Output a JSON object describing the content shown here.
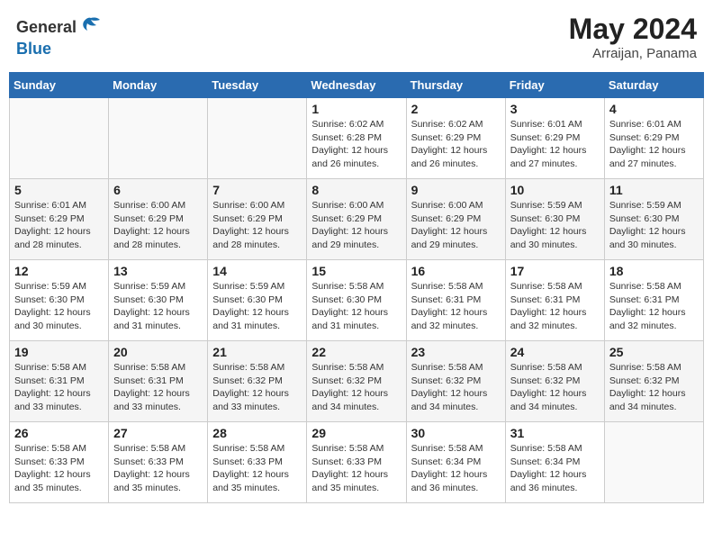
{
  "header": {
    "logo_general": "General",
    "logo_blue": "Blue",
    "month_year": "May 2024",
    "location": "Arraijan, Panama"
  },
  "weekdays": [
    "Sunday",
    "Monday",
    "Tuesday",
    "Wednesday",
    "Thursday",
    "Friday",
    "Saturday"
  ],
  "weeks": [
    [
      {
        "day": "",
        "info": ""
      },
      {
        "day": "",
        "info": ""
      },
      {
        "day": "",
        "info": ""
      },
      {
        "day": "1",
        "info": "Sunrise: 6:02 AM\nSunset: 6:28 PM\nDaylight: 12 hours\nand 26 minutes."
      },
      {
        "day": "2",
        "info": "Sunrise: 6:02 AM\nSunset: 6:29 PM\nDaylight: 12 hours\nand 26 minutes."
      },
      {
        "day": "3",
        "info": "Sunrise: 6:01 AM\nSunset: 6:29 PM\nDaylight: 12 hours\nand 27 minutes."
      },
      {
        "day": "4",
        "info": "Sunrise: 6:01 AM\nSunset: 6:29 PM\nDaylight: 12 hours\nand 27 minutes."
      }
    ],
    [
      {
        "day": "5",
        "info": "Sunrise: 6:01 AM\nSunset: 6:29 PM\nDaylight: 12 hours\nand 28 minutes."
      },
      {
        "day": "6",
        "info": "Sunrise: 6:00 AM\nSunset: 6:29 PM\nDaylight: 12 hours\nand 28 minutes."
      },
      {
        "day": "7",
        "info": "Sunrise: 6:00 AM\nSunset: 6:29 PM\nDaylight: 12 hours\nand 28 minutes."
      },
      {
        "day": "8",
        "info": "Sunrise: 6:00 AM\nSunset: 6:29 PM\nDaylight: 12 hours\nand 29 minutes."
      },
      {
        "day": "9",
        "info": "Sunrise: 6:00 AM\nSunset: 6:29 PM\nDaylight: 12 hours\nand 29 minutes."
      },
      {
        "day": "10",
        "info": "Sunrise: 5:59 AM\nSunset: 6:30 PM\nDaylight: 12 hours\nand 30 minutes."
      },
      {
        "day": "11",
        "info": "Sunrise: 5:59 AM\nSunset: 6:30 PM\nDaylight: 12 hours\nand 30 minutes."
      }
    ],
    [
      {
        "day": "12",
        "info": "Sunrise: 5:59 AM\nSunset: 6:30 PM\nDaylight: 12 hours\nand 30 minutes."
      },
      {
        "day": "13",
        "info": "Sunrise: 5:59 AM\nSunset: 6:30 PM\nDaylight: 12 hours\nand 31 minutes."
      },
      {
        "day": "14",
        "info": "Sunrise: 5:59 AM\nSunset: 6:30 PM\nDaylight: 12 hours\nand 31 minutes."
      },
      {
        "day": "15",
        "info": "Sunrise: 5:58 AM\nSunset: 6:30 PM\nDaylight: 12 hours\nand 31 minutes."
      },
      {
        "day": "16",
        "info": "Sunrise: 5:58 AM\nSunset: 6:31 PM\nDaylight: 12 hours\nand 32 minutes."
      },
      {
        "day": "17",
        "info": "Sunrise: 5:58 AM\nSunset: 6:31 PM\nDaylight: 12 hours\nand 32 minutes."
      },
      {
        "day": "18",
        "info": "Sunrise: 5:58 AM\nSunset: 6:31 PM\nDaylight: 12 hours\nand 32 minutes."
      }
    ],
    [
      {
        "day": "19",
        "info": "Sunrise: 5:58 AM\nSunset: 6:31 PM\nDaylight: 12 hours\nand 33 minutes."
      },
      {
        "day": "20",
        "info": "Sunrise: 5:58 AM\nSunset: 6:31 PM\nDaylight: 12 hours\nand 33 minutes."
      },
      {
        "day": "21",
        "info": "Sunrise: 5:58 AM\nSunset: 6:32 PM\nDaylight: 12 hours\nand 33 minutes."
      },
      {
        "day": "22",
        "info": "Sunrise: 5:58 AM\nSunset: 6:32 PM\nDaylight: 12 hours\nand 34 minutes."
      },
      {
        "day": "23",
        "info": "Sunrise: 5:58 AM\nSunset: 6:32 PM\nDaylight: 12 hours\nand 34 minutes."
      },
      {
        "day": "24",
        "info": "Sunrise: 5:58 AM\nSunset: 6:32 PM\nDaylight: 12 hours\nand 34 minutes."
      },
      {
        "day": "25",
        "info": "Sunrise: 5:58 AM\nSunset: 6:32 PM\nDaylight: 12 hours\nand 34 minutes."
      }
    ],
    [
      {
        "day": "26",
        "info": "Sunrise: 5:58 AM\nSunset: 6:33 PM\nDaylight: 12 hours\nand 35 minutes."
      },
      {
        "day": "27",
        "info": "Sunrise: 5:58 AM\nSunset: 6:33 PM\nDaylight: 12 hours\nand 35 minutes."
      },
      {
        "day": "28",
        "info": "Sunrise: 5:58 AM\nSunset: 6:33 PM\nDaylight: 12 hours\nand 35 minutes."
      },
      {
        "day": "29",
        "info": "Sunrise: 5:58 AM\nSunset: 6:33 PM\nDaylight: 12 hours\nand 35 minutes."
      },
      {
        "day": "30",
        "info": "Sunrise: 5:58 AM\nSunset: 6:34 PM\nDaylight: 12 hours\nand 36 minutes."
      },
      {
        "day": "31",
        "info": "Sunrise: 5:58 AM\nSunset: 6:34 PM\nDaylight: 12 hours\nand 36 minutes."
      },
      {
        "day": "",
        "info": ""
      }
    ]
  ]
}
